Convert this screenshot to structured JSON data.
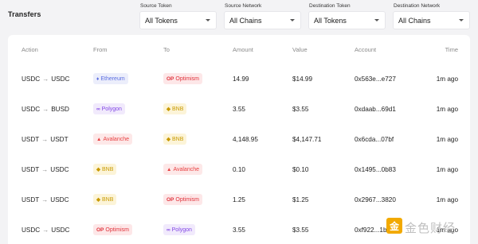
{
  "page_title": "Transfers",
  "filters": [
    {
      "label": "Source Token",
      "value": "All Tokens"
    },
    {
      "label": "Source Network",
      "value": "All Chains"
    },
    {
      "label": "Destination Token",
      "value": "All Tokens"
    },
    {
      "label": "Destination Network",
      "value": "All Chains"
    }
  ],
  "columns": {
    "action": "Action",
    "from": "From",
    "to": "To",
    "amount": "Amount",
    "value": "Value",
    "account": "Account",
    "time": "Time"
  },
  "arrow": "→",
  "chains": {
    "Ethereum": {
      "glyph": "♦",
      "fg": "#5b6ee1",
      "bg": "#eceefb"
    },
    "Optimism": {
      "glyph": "OP",
      "fg": "#e0323b",
      "bg": "#fde7e8"
    },
    "Polygon": {
      "glyph": "∞",
      "fg": "#8247e5",
      "bg": "#f1eafc"
    },
    "BNB": {
      "glyph": "◆",
      "fg": "#c99a00",
      "bg": "#fcf4d8"
    },
    "Avalanche": {
      "glyph": "▲",
      "fg": "#e84142",
      "bg": "#fde8e8"
    }
  },
  "rows": [
    {
      "from_token": "USDC",
      "to_token": "USDC",
      "from_chain": "Ethereum",
      "to_chain": "Optimism",
      "amount": "14.99",
      "value": "$14.99",
      "account": "0x563e...e727",
      "time": "1m ago"
    },
    {
      "from_token": "USDC",
      "to_token": "BUSD",
      "from_chain": "Polygon",
      "to_chain": "BNB",
      "amount": "3.55",
      "value": "$3.55",
      "account": "0xdaab...69d1",
      "time": "1m ago"
    },
    {
      "from_token": "USDT",
      "to_token": "USDT",
      "from_chain": "Avalanche",
      "to_chain": "BNB",
      "amount": "4,148.95",
      "value": "$4,147.71",
      "account": "0x6cda...07bf",
      "time": "1m ago"
    },
    {
      "from_token": "USDT",
      "to_token": "USDC",
      "from_chain": "BNB",
      "to_chain": "Avalanche",
      "amount": "0.10",
      "value": "$0.10",
      "account": "0x1495...0b83",
      "time": "1m ago"
    },
    {
      "from_token": "USDT",
      "to_token": "USDC",
      "from_chain": "BNB",
      "to_chain": "Optimism",
      "amount": "1.25",
      "value": "$1.25",
      "account": "0x2967...3820",
      "time": "1m ago"
    },
    {
      "from_token": "USDC",
      "to_token": "USDC",
      "from_chain": "Optimism",
      "to_chain": "Polygon",
      "amount": "3.55",
      "value": "$3.55",
      "account": "0xf922...1b0",
      "time": "1m ago"
    }
  ],
  "watermark": {
    "logo": "金",
    "text": "金色财经"
  }
}
